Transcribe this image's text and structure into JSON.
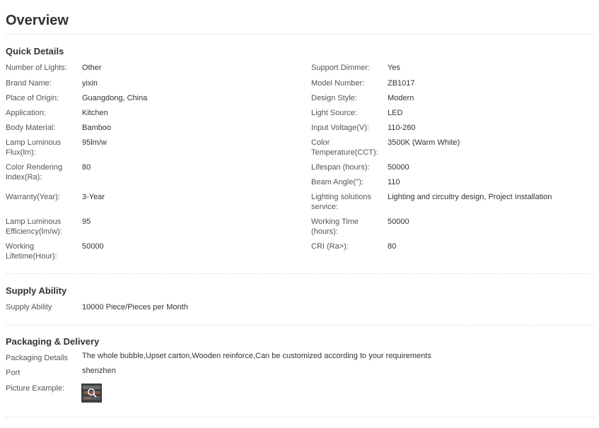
{
  "page": {
    "title": "Overview"
  },
  "quick_details": {
    "title": "Quick Details",
    "left": [
      {
        "label": "Number of Lights:",
        "value": "Other"
      },
      {
        "label": "Brand Name:",
        "value": "yixin"
      },
      {
        "label": "Place of Origin:",
        "value": "Guangdong, China"
      },
      {
        "label": "Application:",
        "value": "Kitchen"
      },
      {
        "label": "Body Material:",
        "value": "Bamboo"
      },
      {
        "label": "Lamp Luminous Flux(lm):",
        "value": "95lm/w"
      },
      {
        "label": "Color Rendering Index(Ra):",
        "value": "80"
      },
      {
        "label": "Warranty(Year):",
        "value": "3-Year"
      },
      {
        "label": "Lamp Luminous Efficiency(lm/w):",
        "value": "95"
      },
      {
        "label": "Working Lifetime(Hour):",
        "value": "50000"
      }
    ],
    "right": [
      {
        "label": "Support Dimmer:",
        "value": "Yes"
      },
      {
        "label": "Model Number:",
        "value": "ZB1017"
      },
      {
        "label": "Design Style:",
        "value": "Modern"
      },
      {
        "label": "Light Source:",
        "value": "LED"
      },
      {
        "label": "Input Voltage(V):",
        "value": "110-260"
      },
      {
        "label": "Color Temperature(CCT):",
        "value": "3500K (Warm White)"
      },
      {
        "label": "Lifespan (hours):",
        "value": "50000"
      },
      {
        "label": "Beam Angle(°):",
        "value": "110"
      },
      {
        "label": "Lighting solutions service:",
        "value": "Lighting and circuitry design, Project Installation"
      },
      {
        "label": "Working Time (hours):",
        "value": "50000"
      },
      {
        "label": "CRI (Ra>):",
        "value": "80"
      }
    ]
  },
  "supply_ability": {
    "title": "Supply Ability",
    "rows": [
      {
        "label": "Supply Ability",
        "value": "10000 Piece/Pieces per Month"
      }
    ]
  },
  "packaging": {
    "title": "Packaging & Delivery",
    "rows": [
      {
        "label": "Packaging Details",
        "value": "The whole bubble,Upset carton,Wooden reinforce,Can be customized according to your requirements"
      },
      {
        "label": "Port",
        "value": "shenzhen"
      },
      {
        "label": "Picture Example:",
        "value": ""
      }
    ]
  },
  "icons": {
    "thumbnail": "picture-example-thumbnail",
    "zoom": "magnifier-icon"
  }
}
